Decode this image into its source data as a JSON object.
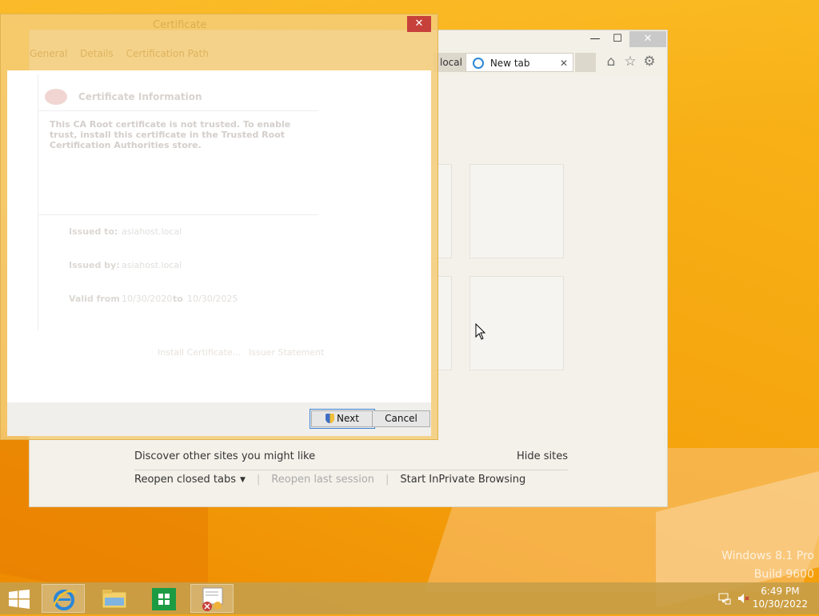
{
  "ie": {
    "inactive_tab_label": "local",
    "active_tab_label": "New tab",
    "tab_close": "✕",
    "window_minimize": "—",
    "window_maximize": "☐",
    "window_close": "✕",
    "discover_text": "Discover other sites you might like",
    "hide_sites": "Hide sites",
    "reopen_closed_tabs": "Reopen closed tabs",
    "reopen_last_session": "Reopen last session",
    "start_inprivate": "Start InPrivate Browsing",
    "icons": [
      "home-icon",
      "favorites-star-icon",
      "tools-gear-icon"
    ]
  },
  "certificate": {
    "title": "Certificate",
    "close": "✕",
    "tabs": [
      "General",
      "Details",
      "Certification Path"
    ],
    "info_title": "Certificate Information",
    "warning": "This CA Root certificate is not trusted. To enable trust, install this certificate in the Trusted Root Certification Authorities store.",
    "issued_to_label": "Issued to:",
    "issued_to_value": "asiahost.local",
    "issued_by_label": "Issued by:",
    "issued_by_value": "asiahost.local",
    "valid_from_label": "Valid from",
    "valid_from_value": "10/30/2020",
    "valid_to_label": "to",
    "valid_to_value": "10/30/2025",
    "install_button": "Install Certificate...",
    "issuer_statement": "Issuer Statement",
    "next_button": "Next",
    "cancel_button": "Cancel"
  },
  "watermark": {
    "line1": "Windows 8.1 Pro",
    "line2": "Build 9600"
  },
  "taskbar": {
    "apps": [
      "internet-explorer",
      "file-explorer",
      "windows-store",
      "certificate-manager"
    ],
    "time": "6:49 PM",
    "date": "10/30/2022"
  },
  "colors": {
    "desktop": "#f7a713",
    "dialog_frame": "#f4cd78",
    "close_red": "#c7413b",
    "accent_blue": "#3b84d8"
  }
}
